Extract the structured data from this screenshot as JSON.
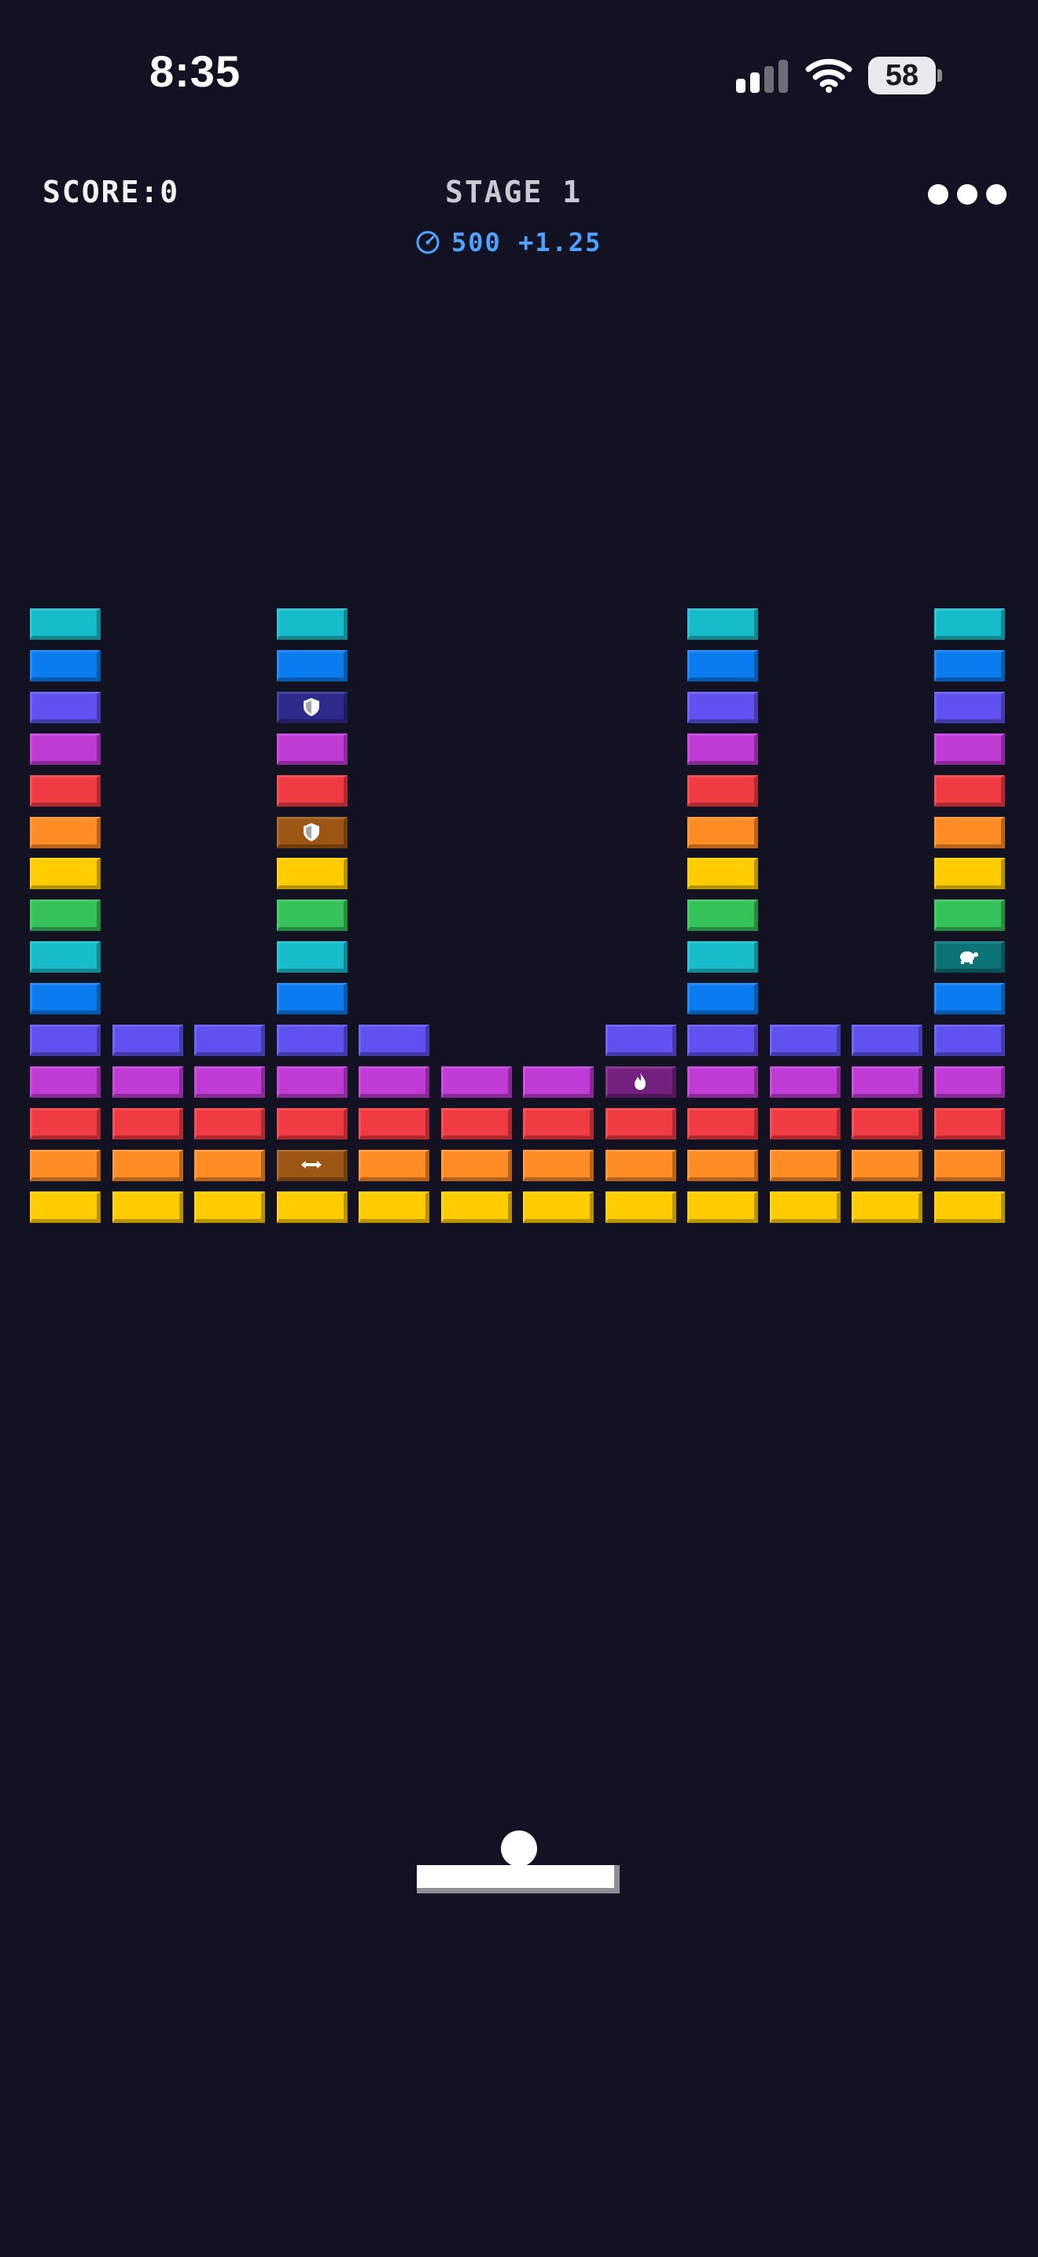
{
  "status_bar": {
    "time": "8:35",
    "battery": "58",
    "signal_icon": "cellular-signal-icon",
    "wifi_icon": "wifi-icon"
  },
  "hud": {
    "score_label": "SCORE:0",
    "stage_label": "STAGE 1",
    "speed_icon": "speedometer-icon",
    "speed_text": "500 +1.25",
    "menu_icon": "more-dots-icon"
  },
  "colors": {
    "background": "#131222",
    "cyan": "#17bccb",
    "blue": "#0a7cf0",
    "indigo": "#6151f0",
    "magenta": "#c13bd6",
    "red": "#f03b43",
    "orange": "#ff8c25",
    "yellow": "#ffcc00",
    "green": "#34c259",
    "powerup_indigo": "#2e2a8c",
    "powerup_orange": "#9d5614",
    "powerup_magenta": "#73207f",
    "powerup_teal": "#0c7377",
    "speed_text": "#4da3ff"
  },
  "bricks": {
    "columns": 12,
    "rows": [
      {
        "row": 0,
        "cells": [
          [
            0,
            "cyan"
          ],
          [
            3,
            "cyan"
          ],
          [
            8,
            "cyan"
          ],
          [
            11,
            "cyan"
          ]
        ]
      },
      {
        "row": 1,
        "cells": [
          [
            0,
            "blue"
          ],
          [
            3,
            "blue"
          ],
          [
            8,
            "blue"
          ],
          [
            11,
            "blue"
          ]
        ]
      },
      {
        "row": 2,
        "cells": [
          [
            0,
            "indigo"
          ],
          [
            3,
            "powerup_indigo",
            "shield-icon"
          ],
          [
            8,
            "indigo"
          ],
          [
            11,
            "indigo"
          ]
        ]
      },
      {
        "row": 3,
        "cells": [
          [
            0,
            "magenta"
          ],
          [
            3,
            "magenta"
          ],
          [
            8,
            "magenta"
          ],
          [
            11,
            "magenta"
          ]
        ]
      },
      {
        "row": 4,
        "cells": [
          [
            0,
            "red"
          ],
          [
            3,
            "red"
          ],
          [
            8,
            "red"
          ],
          [
            11,
            "red"
          ]
        ]
      },
      {
        "row": 5,
        "cells": [
          [
            0,
            "orange"
          ],
          [
            3,
            "powerup_orange",
            "shield-icon"
          ],
          [
            8,
            "orange"
          ],
          [
            11,
            "orange"
          ]
        ]
      },
      {
        "row": 6,
        "cells": [
          [
            0,
            "yellow"
          ],
          [
            3,
            "yellow"
          ],
          [
            8,
            "yellow"
          ],
          [
            11,
            "yellow"
          ]
        ]
      },
      {
        "row": 7,
        "cells": [
          [
            0,
            "green"
          ],
          [
            3,
            "green"
          ],
          [
            8,
            "green"
          ],
          [
            11,
            "green"
          ]
        ]
      },
      {
        "row": 8,
        "cells": [
          [
            0,
            "cyan"
          ],
          [
            3,
            "cyan"
          ],
          [
            8,
            "cyan"
          ],
          [
            11,
            "powerup_teal",
            "turtle-icon"
          ]
        ]
      },
      {
        "row": 9,
        "cells": [
          [
            0,
            "blue"
          ],
          [
            3,
            "blue"
          ],
          [
            8,
            "blue"
          ],
          [
            11,
            "blue"
          ]
        ]
      },
      {
        "row": 10,
        "cells": [
          [
            0,
            "indigo"
          ],
          [
            1,
            "indigo"
          ],
          [
            2,
            "indigo"
          ],
          [
            3,
            "indigo"
          ],
          [
            4,
            "indigo"
          ],
          [
            7,
            "indigo"
          ],
          [
            8,
            "indigo"
          ],
          [
            9,
            "indigo"
          ],
          [
            10,
            "indigo"
          ],
          [
            11,
            "indigo"
          ]
        ]
      },
      {
        "row": 11,
        "cells": [
          [
            0,
            "magenta"
          ],
          [
            1,
            "magenta"
          ],
          [
            2,
            "magenta"
          ],
          [
            3,
            "magenta"
          ],
          [
            4,
            "magenta"
          ],
          [
            5,
            "magenta"
          ],
          [
            6,
            "magenta"
          ],
          [
            7,
            "powerup_magenta",
            "fire-icon"
          ],
          [
            8,
            "magenta"
          ],
          [
            9,
            "magenta"
          ],
          [
            10,
            "magenta"
          ],
          [
            11,
            "magenta"
          ]
        ]
      },
      {
        "row": 12,
        "cells": [
          [
            0,
            "red"
          ],
          [
            1,
            "red"
          ],
          [
            2,
            "red"
          ],
          [
            3,
            "red"
          ],
          [
            4,
            "red"
          ],
          [
            5,
            "red"
          ],
          [
            6,
            "red"
          ],
          [
            7,
            "red"
          ],
          [
            8,
            "red"
          ],
          [
            9,
            "red"
          ],
          [
            10,
            "red"
          ],
          [
            11,
            "red"
          ]
        ]
      },
      {
        "row": 13,
        "cells": [
          [
            0,
            "orange"
          ],
          [
            1,
            "orange"
          ],
          [
            2,
            "orange"
          ],
          [
            3,
            "powerup_orange",
            "expand-arrows-icon"
          ],
          [
            4,
            "orange"
          ],
          [
            5,
            "orange"
          ],
          [
            6,
            "orange"
          ],
          [
            7,
            "orange"
          ],
          [
            8,
            "orange"
          ],
          [
            9,
            "orange"
          ],
          [
            10,
            "orange"
          ],
          [
            11,
            "orange"
          ]
        ]
      },
      {
        "row": 14,
        "cells": [
          [
            0,
            "yellow"
          ],
          [
            1,
            "yellow"
          ],
          [
            2,
            "yellow"
          ],
          [
            3,
            "yellow"
          ],
          [
            4,
            "yellow"
          ],
          [
            5,
            "yellow"
          ],
          [
            6,
            "yellow"
          ],
          [
            7,
            "yellow"
          ],
          [
            8,
            "yellow"
          ],
          [
            9,
            "yellow"
          ],
          [
            10,
            "yellow"
          ],
          [
            11,
            "yellow"
          ]
        ]
      }
    ]
  }
}
